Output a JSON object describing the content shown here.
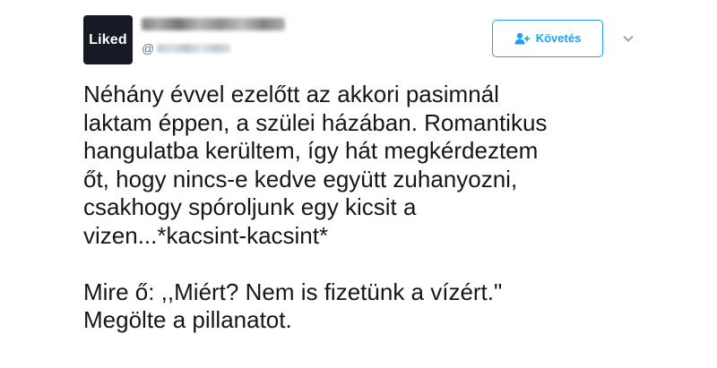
{
  "author": {
    "avatar_text": "Liked",
    "handle_prefix": "@"
  },
  "follow_button": {
    "label": "Követés",
    "icon": "person-plus-icon"
  },
  "menu": {
    "icon": "chevron-down-icon"
  },
  "tweet": {
    "paragraph_1_lines": [
      "Néhány évvel ezelőtt az akkori pasimnál",
      "laktam éppen, a szülei házában. Romantikus",
      "hangulatba kerültem, így hát megkérdeztem",
      "őt, hogy nincs-e kedve együtt zuhanyozni,",
      "csakhogy spóroljunk egy kicsit a",
      "vizen...*kacsint-kacsint*"
    ],
    "paragraph_2_lines": [
      "Mire ő: ,,Miért? Nem is fizetünk a vízért.\"",
      "Megölte a pillanatot."
    ]
  },
  "colors": {
    "accent": "#1da1f2",
    "text": "#14171a",
    "muted": "#657786",
    "avatar_bg": "#151a24"
  }
}
